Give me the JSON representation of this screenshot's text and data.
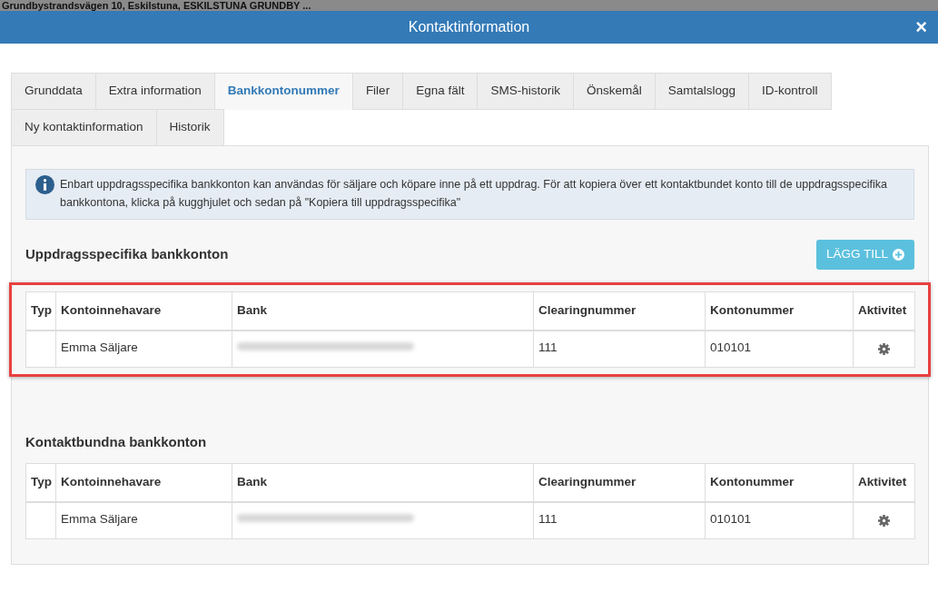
{
  "background_text": "Grundbystrandsvägen 10, Eskilstuna, ESKILSTUNA GRUNDBY ...",
  "window": {
    "title": "Kontaktinformation",
    "close": "×"
  },
  "tabs": [
    {
      "label": "Grunddata",
      "selected": false
    },
    {
      "label": "Extra information",
      "selected": false
    },
    {
      "label": "Bankkontonummer",
      "selected": true
    },
    {
      "label": "Filer",
      "selected": false
    },
    {
      "label": "Egna fält",
      "selected": false
    },
    {
      "label": "SMS-historik",
      "selected": false
    },
    {
      "label": "Önskemål",
      "selected": false
    },
    {
      "label": "Samtalslogg",
      "selected": false
    },
    {
      "label": "ID-kontroll",
      "selected": false
    },
    {
      "label": "Ny kontaktinformation",
      "selected": false
    },
    {
      "label": "Historik",
      "selected": false
    }
  ],
  "info": "Enbart uppdragsspecifika bankkonton kan användas för säljare och köpare inne på ett uppdrag. För att kopiera över ett kontaktbundet konto till de uppdragsspecifika bankkontona, klicka på kugghjulet och sedan på \"Kopiera till uppdragsspecifika\"",
  "sections": [
    {
      "title": "Uppdragsspecifika bankkonton",
      "add_button": "LÄGG TILL",
      "highlighted": true,
      "columns": [
        "Typ",
        "Kontoinnehavare",
        "Bank",
        "Clearingnummer",
        "Kontonummer",
        "Aktivitet"
      ],
      "rows": [
        {
          "holder": "Emma Säljare",
          "clearing": "111",
          "account": "010101"
        }
      ]
    },
    {
      "title": "Kontaktbundna bankkonton",
      "highlighted": false,
      "columns": [
        "Typ",
        "Kontoinnehavare",
        "Bank",
        "Clearingnummer",
        "Kontonummer",
        "Aktivitet"
      ],
      "rows": [
        {
          "holder": "Emma Säljare",
          "clearing": "111",
          "account": "010101"
        }
      ]
    }
  ]
}
